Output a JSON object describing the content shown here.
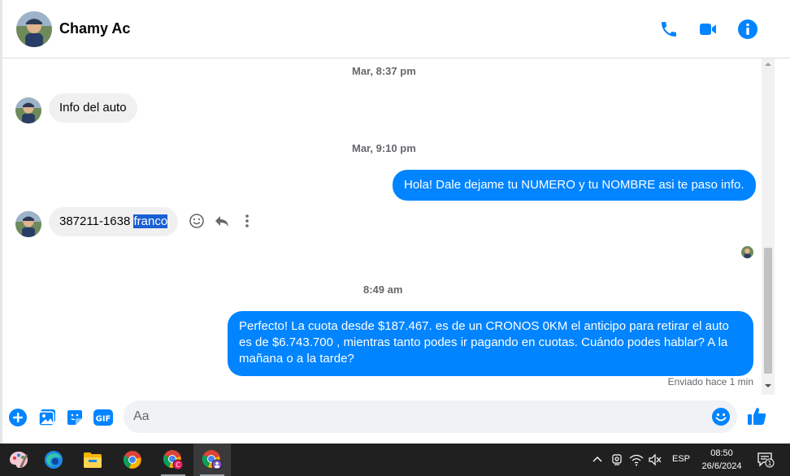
{
  "header": {
    "contact_name": "Chamy Ac",
    "icons": [
      "phone-icon",
      "video-icon",
      "info-icon"
    ]
  },
  "messages": {
    "ts1": "Mar, 8:37 pm",
    "msg1": "Info del auto",
    "ts2": "Mar, 9:10 pm",
    "msg2": "Hola! Dale dejame tu NUMERO y tu NOMBRE asi te paso info.",
    "msg3_number": "387211-1638",
    "msg3_selected": "franco",
    "ts3": "8:49 am",
    "msg4": "Perfecto! La cuota desde $187.467. es de un CRONOS 0KM el anticipo para retirar el auto es de $6.743.700 , mientras tanto podes ir pagando en cuotas. Cuándo podes hablar? A la mañana o a la tarde?",
    "status": "Enviado hace 1 min"
  },
  "composer": {
    "placeholder": "Aa",
    "value": ""
  },
  "taskbar": {
    "lang": "ESP",
    "time": "08:50",
    "date": "26/6/2024",
    "notification_count": "1"
  },
  "colors": {
    "accent": "#0084ff",
    "bubble_in": "#f0f0f0",
    "taskbar": "#202020"
  }
}
